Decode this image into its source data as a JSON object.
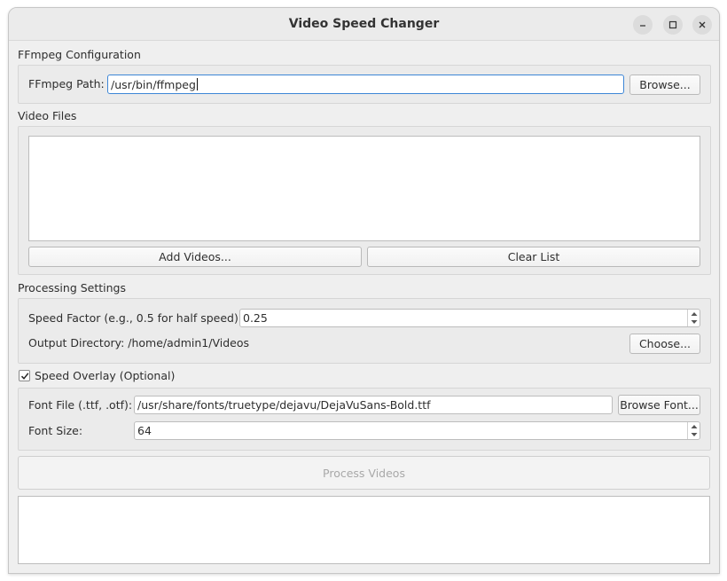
{
  "window": {
    "title": "Video Speed Changer"
  },
  "ffmpeg": {
    "group_label": "FFmpeg Configuration",
    "path_label": "FFmpeg Path:",
    "path_value": "/usr/bin/ffmpeg",
    "browse_label": "Browse..."
  },
  "video_files": {
    "group_label": "Video Files",
    "items": [],
    "add_label": "Add Videos...",
    "clear_label": "Clear List"
  },
  "processing": {
    "group_label": "Processing Settings",
    "speed_label": "Speed Factor (e.g., 0.5 for half speed):",
    "speed_value": "0.25",
    "output_label": "Output Directory: /home/admin1/Videos",
    "choose_label": "Choose..."
  },
  "overlay": {
    "checkbox_label": "Speed Overlay (Optional)",
    "checked": true,
    "font_file_label": "Font File (.ttf, .otf):",
    "font_file_value": "/usr/share/fonts/truetype/dejavu/DejaVuSans-Bold.ttf",
    "browse_font_label": "Browse Font...",
    "font_size_label": "Font Size:",
    "font_size_value": "64"
  },
  "actions": {
    "process_label": "Process Videos"
  },
  "log": {
    "text": ""
  }
}
